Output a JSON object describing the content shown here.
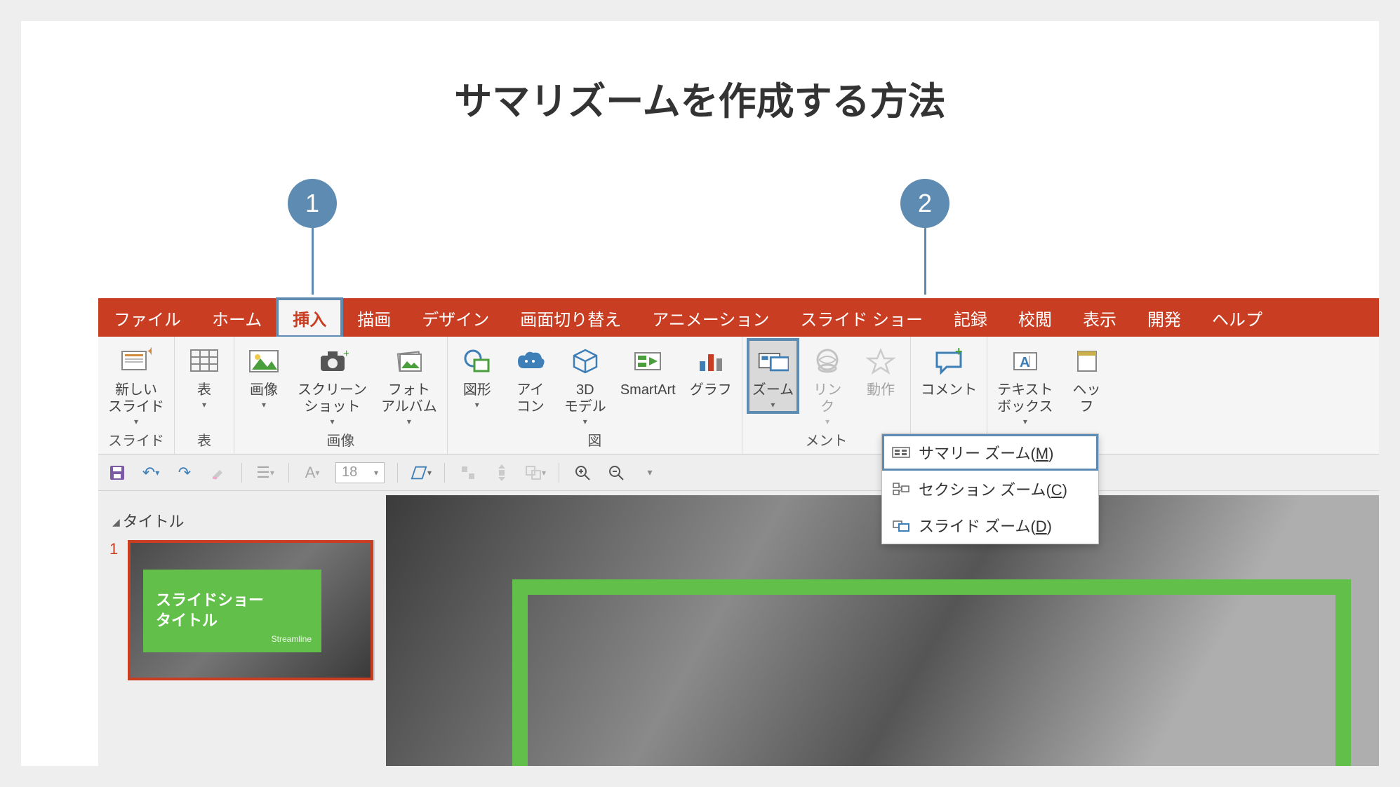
{
  "page_title": "サマリズームを作成する方法",
  "callouts": {
    "c1": "1",
    "c2": "2"
  },
  "tabs": {
    "file": "ファイル",
    "home": "ホーム",
    "insert": "挿入",
    "draw": "描画",
    "design": "デザイン",
    "transitions": "画面切り替え",
    "animations": "アニメーション",
    "slideshow": "スライド ショー",
    "record": "記録",
    "review": "校閲",
    "view": "表示",
    "developer": "開発",
    "help": "ヘルプ"
  },
  "groups": {
    "slides": "スライド",
    "tables": "表",
    "images": "画像",
    "illustrations": "図",
    "comment_trail": "メント"
  },
  "ribbon": {
    "new_slide": "新しい\nスライド",
    "table": "表",
    "pictures": "画像",
    "screenshot": "スクリーン\nショット",
    "photo_album": "フォト\nアルバム",
    "shapes": "図形",
    "icons": "アイ\nコン",
    "models3d": "3D\nモデル",
    "smartart": "SmartArt",
    "chart": "グラフ",
    "zoom": "ズーム",
    "link": "リン\nク",
    "action": "動作",
    "comment": "コメント",
    "textbox": "テキスト\nボックス",
    "header_partial": "ヘッ\nフ"
  },
  "zoom_menu": {
    "summary": "サマリー ズーム(",
    "summary_k": "M",
    "summary_end": ")",
    "section": "セクション ズーム(",
    "section_k": "C",
    "section_end": ")",
    "slide": "スライド ズーム(",
    "slide_k": "D",
    "slide_end": ")"
  },
  "qat": {
    "font_size": "18"
  },
  "panel": {
    "section": "タイトル",
    "slide_num": "1",
    "slide_title": "スライドショー\nタイトル",
    "slide_sub": "Streamline"
  }
}
